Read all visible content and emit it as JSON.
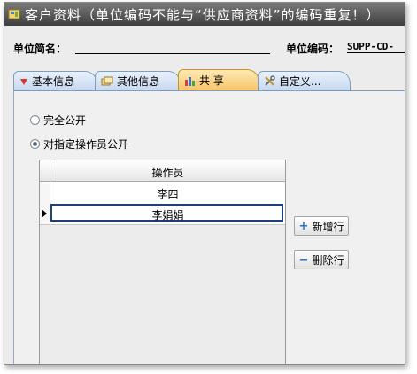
{
  "window": {
    "title": "客户资料（单位编码不能与“供应商资料”的编码重复！）"
  },
  "header": {
    "name_label": "单位简名：",
    "code_label": "单位编码：",
    "code_value": "SUPP-CD-"
  },
  "tabs": [
    {
      "label": "基本信息",
      "icon": "arrow-down-icon"
    },
    {
      "label": "其他信息",
      "icon": "cards-icon"
    },
    {
      "label": "共 享",
      "icon": "bar-chart-icon",
      "active": true
    },
    {
      "label": "自定义...",
      "icon": "tools-icon"
    }
  ],
  "share": {
    "options": [
      {
        "label": "完全公开",
        "selected": false
      },
      {
        "label": "对指定操作员公开",
        "selected": true
      }
    ],
    "grid": {
      "column": "操作员",
      "rows": [
        "李四",
        "李娟娟"
      ],
      "current_row": 1
    },
    "buttons": {
      "add": {
        "label": "新增行",
        "icon": "+"
      },
      "delete": {
        "label": "删除行",
        "icon": "−"
      }
    }
  },
  "colors": {
    "title_bar": "#4f4f4f",
    "tab_active": "#f6c66a",
    "tab_inactive": "#c6d8ef"
  }
}
